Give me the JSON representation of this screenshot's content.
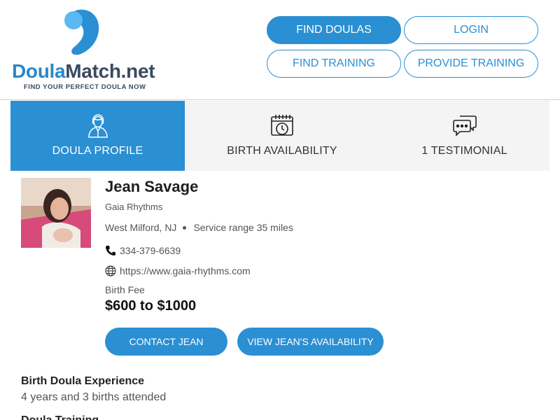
{
  "brand": {
    "name_part1": "Doula",
    "name_part2": "Match.net",
    "tagline": "FIND YOUR PERFECT DOULA NOW",
    "colors": {
      "primary": "#2b8fd3",
      "dark": "#3a4a60",
      "light": "#5bb8f0"
    }
  },
  "nav": {
    "find_doulas": "FIND DOULAS",
    "login": "LOGIN",
    "find_training": "FIND TRAINING",
    "provide_training": "PROVIDE TRAINING"
  },
  "tabs": [
    {
      "label": "DOULA PROFILE",
      "icon": "doula-person-icon",
      "active": true
    },
    {
      "label": "BIRTH AVAILABILITY",
      "icon": "calendar-clock-icon",
      "active": false
    },
    {
      "label": "1 TESTIMONIAL",
      "icon": "chat-bubbles-icon",
      "active": false
    }
  ],
  "profile": {
    "name": "Jean Savage",
    "business": "Gaia Rhythms",
    "location": "West Milford, NJ",
    "service_range": "Service range 35 miles",
    "phone": "334-379-6639",
    "website": "https://www.gaia-rhythms.com",
    "fee_label": "Birth Fee",
    "fee_value": "$600 to $1000",
    "contact_button": "CONTACT JEAN",
    "availability_button": "VIEW JEAN'S AVAILABILITY",
    "photo_icon": "profile-photo"
  },
  "sections": {
    "experience_title": "Birth Doula Experience",
    "experience_text": "4 years and 3 births attended",
    "training_title": "Doula Training"
  }
}
